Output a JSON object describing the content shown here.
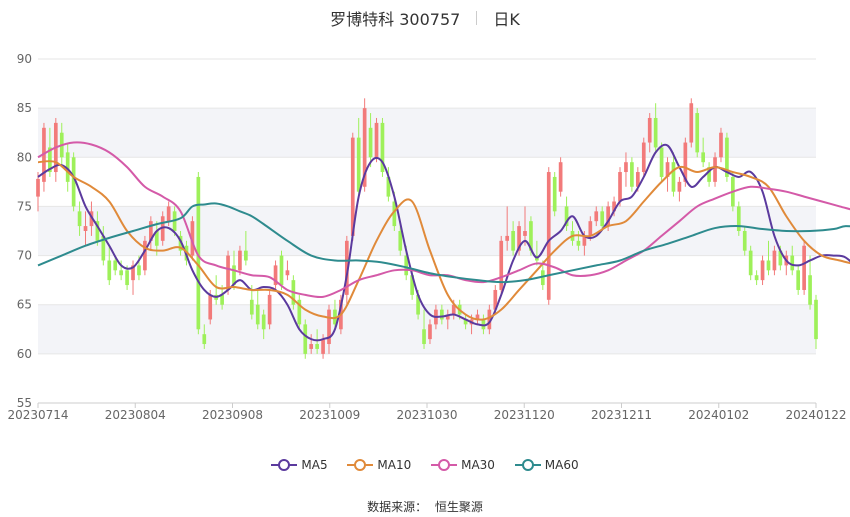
{
  "title": {
    "name": "罗博特科 300757",
    "period": "日K"
  },
  "source": {
    "label": "数据来源：",
    "value": "恒生聚源"
  },
  "colors": {
    "up": "#f27a7a",
    "down": "#9ef05a",
    "grid": "#e6e6e6",
    "band": "#f3f4f8",
    "axis_text": "#666666"
  },
  "chart_data": {
    "type": "candlestick",
    "ylim": [
      55,
      90
    ],
    "yticks": [
      55,
      60,
      65,
      70,
      75,
      80,
      85,
      90
    ],
    "xticks": [
      "20230714",
      "20230804",
      "20230908",
      "20231009",
      "20231030",
      "20231120",
      "20231211",
      "20240102",
      "20240122"
    ],
    "candles": [
      {
        "o": 76.0,
        "h": 78.5,
        "l": 74.5,
        "c": 77.8
      },
      {
        "o": 77.5,
        "h": 83.5,
        "l": 76.5,
        "c": 83.0
      },
      {
        "o": 81.0,
        "h": 83.0,
        "l": 78.0,
        "c": 78.5
      },
      {
        "o": 78.5,
        "h": 84.0,
        "l": 77.5,
        "c": 83.5
      },
      {
        "o": 82.5,
        "h": 83.5,
        "l": 79.0,
        "c": 80.0
      },
      {
        "o": 80.5,
        "h": 81.5,
        "l": 76.5,
        "c": 77.5
      },
      {
        "o": 80.0,
        "h": 80.5,
        "l": 74.5,
        "c": 75.0
      },
      {
        "o": 74.5,
        "h": 75.5,
        "l": 72.0,
        "c": 73.0
      },
      {
        "o": 72.5,
        "h": 74.5,
        "l": 71.0,
        "c": 73.0
      },
      {
        "o": 73.0,
        "h": 75.5,
        "l": 72.0,
        "c": 74.5
      },
      {
        "o": 73.5,
        "h": 74.5,
        "l": 71.0,
        "c": 71.5
      },
      {
        "o": 72.0,
        "h": 73.0,
        "l": 69.0,
        "c": 69.5
      },
      {
        "o": 69.5,
        "h": 71.0,
        "l": 67.0,
        "c": 67.5
      },
      {
        "o": 69.5,
        "h": 70.0,
        "l": 68.0,
        "c": 68.5
      },
      {
        "o": 68.5,
        "h": 69.5,
        "l": 67.5,
        "c": 68.0
      },
      {
        "o": 68.5,
        "h": 69.0,
        "l": 66.5,
        "c": 67.0
      },
      {
        "o": 67.5,
        "h": 69.5,
        "l": 66.0,
        "c": 69.0
      },
      {
        "o": 69.0,
        "h": 70.0,
        "l": 67.5,
        "c": 68.0
      },
      {
        "o": 68.5,
        "h": 72.0,
        "l": 68.0,
        "c": 71.5
      },
      {
        "o": 71.5,
        "h": 74.0,
        "l": 70.5,
        "c": 73.5
      },
      {
        "o": 72.5,
        "h": 73.5,
        "l": 70.0,
        "c": 71.0
      },
      {
        "o": 71.5,
        "h": 74.5,
        "l": 71.0,
        "c": 74.0
      },
      {
        "o": 73.5,
        "h": 75.5,
        "l": 73.0,
        "c": 75.0
      },
      {
        "o": 74.5,
        "h": 75.0,
        "l": 72.0,
        "c": 72.5
      },
      {
        "o": 72.0,
        "h": 72.5,
        "l": 70.0,
        "c": 70.5
      },
      {
        "o": 71.0,
        "h": 71.5,
        "l": 69.0,
        "c": 69.5
      },
      {
        "o": 70.0,
        "h": 74.0,
        "l": 69.5,
        "c": 73.5
      },
      {
        "o": 78.0,
        "h": 78.5,
        "l": 62.0,
        "c": 62.5
      },
      {
        "o": 62.0,
        "h": 63.0,
        "l": 60.5,
        "c": 61.0
      },
      {
        "o": 63.5,
        "h": 66.5,
        "l": 63.0,
        "c": 66.0
      },
      {
        "o": 66.0,
        "h": 68.0,
        "l": 65.0,
        "c": 65.5
      },
      {
        "o": 66.0,
        "h": 67.0,
        "l": 64.5,
        "c": 65.0
      },
      {
        "o": 66.5,
        "h": 70.5,
        "l": 66.0,
        "c": 70.0
      },
      {
        "o": 69.0,
        "h": 70.5,
        "l": 66.5,
        "c": 67.0
      },
      {
        "o": 68.5,
        "h": 71.0,
        "l": 68.0,
        "c": 70.5
      },
      {
        "o": 70.5,
        "h": 72.5,
        "l": 69.0,
        "c": 69.5
      },
      {
        "o": 65.5,
        "h": 67.0,
        "l": 63.5,
        "c": 64.0
      },
      {
        "o": 65.0,
        "h": 66.5,
        "l": 62.5,
        "c": 63.0
      },
      {
        "o": 64.0,
        "h": 64.5,
        "l": 61.5,
        "c": 62.5
      },
      {
        "o": 63.0,
        "h": 66.5,
        "l": 62.5,
        "c": 66.0
      },
      {
        "o": 67.0,
        "h": 69.5,
        "l": 66.5,
        "c": 69.0
      },
      {
        "o": 70.0,
        "h": 70.5,
        "l": 66.5,
        "c": 67.0
      },
      {
        "o": 68.0,
        "h": 69.5,
        "l": 67.5,
        "c": 68.5
      },
      {
        "o": 67.5,
        "h": 68.0,
        "l": 64.5,
        "c": 65.0
      },
      {
        "o": 65.5,
        "h": 66.0,
        "l": 62.5,
        "c": 63.0
      },
      {
        "o": 63.0,
        "h": 63.5,
        "l": 59.5,
        "c": 60.0
      },
      {
        "o": 60.5,
        "h": 62.0,
        "l": 60.0,
        "c": 61.0
      },
      {
        "o": 61.0,
        "h": 62.5,
        "l": 60.0,
        "c": 60.5
      },
      {
        "o": 60.0,
        "h": 62.0,
        "l": 59.5,
        "c": 61.5
      },
      {
        "o": 61.0,
        "h": 65.0,
        "l": 60.0,
        "c": 64.5
      },
      {
        "o": 64.5,
        "h": 65.5,
        "l": 62.5,
        "c": 63.0
      },
      {
        "o": 62.5,
        "h": 66.0,
        "l": 62.0,
        "c": 65.5
      },
      {
        "o": 66.0,
        "h": 72.0,
        "l": 65.0,
        "c": 71.5
      },
      {
        "o": 72.0,
        "h": 82.5,
        "l": 71.5,
        "c": 82.0
      },
      {
        "o": 82.0,
        "h": 84.0,
        "l": 76.0,
        "c": 76.5
      },
      {
        "o": 77.0,
        "h": 86.0,
        "l": 76.5,
        "c": 85.0
      },
      {
        "o": 83.0,
        "h": 84.5,
        "l": 79.0,
        "c": 80.0
      },
      {
        "o": 80.0,
        "h": 84.0,
        "l": 79.5,
        "c": 83.5
      },
      {
        "o": 83.5,
        "h": 84.0,
        "l": 78.0,
        "c": 78.5
      },
      {
        "o": 78.0,
        "h": 79.0,
        "l": 75.5,
        "c": 76.0
      },
      {
        "o": 75.5,
        "h": 76.5,
        "l": 72.5,
        "c": 73.0
      },
      {
        "o": 72.5,
        "h": 73.5,
        "l": 70.0,
        "c": 70.5
      },
      {
        "o": 70.0,
        "h": 71.0,
        "l": 67.5,
        "c": 68.0
      },
      {
        "o": 68.0,
        "h": 68.5,
        "l": 65.5,
        "c": 66.0
      },
      {
        "o": 66.0,
        "h": 66.5,
        "l": 63.5,
        "c": 64.0
      },
      {
        "o": 62.5,
        "h": 64.5,
        "l": 60.5,
        "c": 61.0
      },
      {
        "o": 61.5,
        "h": 63.5,
        "l": 61.0,
        "c": 63.0
      },
      {
        "o": 63.0,
        "h": 65.0,
        "l": 62.5,
        "c": 64.5
      },
      {
        "o": 64.5,
        "h": 65.0,
        "l": 63.0,
        "c": 63.5
      },
      {
        "o": 63.5,
        "h": 64.5,
        "l": 62.5,
        "c": 64.0
      },
      {
        "o": 64.0,
        "h": 65.5,
        "l": 63.5,
        "c": 65.0
      },
      {
        "o": 65.0,
        "h": 65.5,
        "l": 63.5,
        "c": 64.0
      },
      {
        "o": 63.5,
        "h": 64.0,
        "l": 62.5,
        "c": 63.0
      },
      {
        "o": 63.0,
        "h": 64.0,
        "l": 62.0,
        "c": 63.5
      },
      {
        "o": 63.5,
        "h": 64.5,
        "l": 63.0,
        "c": 64.0
      },
      {
        "o": 63.5,
        "h": 64.0,
        "l": 62.0,
        "c": 62.5
      },
      {
        "o": 62.5,
        "h": 65.0,
        "l": 62.0,
        "c": 64.5
      },
      {
        "o": 64.5,
        "h": 67.0,
        "l": 64.0,
        "c": 66.5
      },
      {
        "o": 66.5,
        "h": 72.0,
        "l": 66.0,
        "c": 71.5
      },
      {
        "o": 71.5,
        "h": 75.0,
        "l": 70.5,
        "c": 72.0
      },
      {
        "o": 72.5,
        "h": 73.5,
        "l": 70.0,
        "c": 70.5
      },
      {
        "o": 70.5,
        "h": 73.5,
        "l": 70.0,
        "c": 73.0
      },
      {
        "o": 72.0,
        "h": 75.0,
        "l": 71.0,
        "c": 72.5
      },
      {
        "o": 73.5,
        "h": 74.0,
        "l": 70.0,
        "c": 70.5
      },
      {
        "o": 70.0,
        "h": 71.5,
        "l": 69.0,
        "c": 69.5
      },
      {
        "o": 68.5,
        "h": 69.5,
        "l": 66.5,
        "c": 67.0
      },
      {
        "o": 65.5,
        "h": 79.0,
        "l": 65.0,
        "c": 78.5
      },
      {
        "o": 78.0,
        "h": 78.5,
        "l": 74.0,
        "c": 74.5
      },
      {
        "o": 76.5,
        "h": 80.0,
        "l": 76.0,
        "c": 79.5
      },
      {
        "o": 75.0,
        "h": 76.0,
        "l": 72.5,
        "c": 73.0
      },
      {
        "o": 72.5,
        "h": 73.5,
        "l": 71.0,
        "c": 71.5
      },
      {
        "o": 71.5,
        "h": 72.5,
        "l": 70.5,
        "c": 71.0
      },
      {
        "o": 71.0,
        "h": 72.5,
        "l": 70.0,
        "c": 72.0
      },
      {
        "o": 72.0,
        "h": 74.0,
        "l": 71.5,
        "c": 73.5
      },
      {
        "o": 73.5,
        "h": 75.0,
        "l": 73.0,
        "c": 74.5
      },
      {
        "o": 74.5,
        "h": 75.0,
        "l": 72.5,
        "c": 73.0
      },
      {
        "o": 73.0,
        "h": 75.5,
        "l": 72.5,
        "c": 75.0
      },
      {
        "o": 74.5,
        "h": 76.0,
        "l": 74.0,
        "c": 75.5
      },
      {
        "o": 75.5,
        "h": 79.0,
        "l": 75.0,
        "c": 78.5
      },
      {
        "o": 78.5,
        "h": 80.5,
        "l": 77.0,
        "c": 79.5
      },
      {
        "o": 79.5,
        "h": 80.0,
        "l": 76.5,
        "c": 77.0
      },
      {
        "o": 77.0,
        "h": 79.0,
        "l": 76.5,
        "c": 78.5
      },
      {
        "o": 78.5,
        "h": 82.0,
        "l": 78.0,
        "c": 81.5
      },
      {
        "o": 81.5,
        "h": 84.5,
        "l": 80.5,
        "c": 84.0
      },
      {
        "o": 84.0,
        "h": 85.5,
        "l": 80.5,
        "c": 81.0
      },
      {
        "o": 81.0,
        "h": 81.5,
        "l": 77.5,
        "c": 78.0
      },
      {
        "o": 78.0,
        "h": 80.0,
        "l": 76.5,
        "c": 79.5
      },
      {
        "o": 79.5,
        "h": 80.5,
        "l": 76.0,
        "c": 76.5
      },
      {
        "o": 76.5,
        "h": 78.0,
        "l": 75.5,
        "c": 77.5
      },
      {
        "o": 77.5,
        "h": 82.0,
        "l": 77.0,
        "c": 81.5
      },
      {
        "o": 81.5,
        "h": 86.0,
        "l": 81.0,
        "c": 85.5
      },
      {
        "o": 84.5,
        "h": 85.0,
        "l": 80.0,
        "c": 80.5
      },
      {
        "o": 80.5,
        "h": 82.0,
        "l": 79.0,
        "c": 79.5
      },
      {
        "o": 79.0,
        "h": 79.5,
        "l": 77.0,
        "c": 77.5
      },
      {
        "o": 77.5,
        "h": 80.5,
        "l": 77.0,
        "c": 80.0
      },
      {
        "o": 80.0,
        "h": 83.0,
        "l": 79.5,
        "c": 82.5
      },
      {
        "o": 82.0,
        "h": 82.5,
        "l": 77.5,
        "c": 78.0
      },
      {
        "o": 78.0,
        "h": 78.5,
        "l": 74.5,
        "c": 75.0
      },
      {
        "o": 75.0,
        "h": 75.5,
        "l": 72.0,
        "c": 72.5
      },
      {
        "o": 72.5,
        "h": 73.0,
        "l": 70.0,
        "c": 70.5
      },
      {
        "o": 70.5,
        "h": 71.0,
        "l": 67.5,
        "c": 68.0
      },
      {
        "o": 68.0,
        "h": 68.5,
        "l": 67.0,
        "c": 67.5
      },
      {
        "o": 67.5,
        "h": 70.0,
        "l": 67.0,
        "c": 69.5
      },
      {
        "o": 69.5,
        "h": 71.5,
        "l": 68.0,
        "c": 68.5
      },
      {
        "o": 68.5,
        "h": 71.0,
        "l": 68.0,
        "c": 70.5
      },
      {
        "o": 70.5,
        "h": 71.0,
        "l": 68.5,
        "c": 69.0
      },
      {
        "o": 69.0,
        "h": 70.5,
        "l": 68.0,
        "c": 70.0
      },
      {
        "o": 70.0,
        "h": 71.0,
        "l": 68.0,
        "c": 68.5
      },
      {
        "o": 68.5,
        "h": 69.0,
        "l": 66.0,
        "c": 66.5
      },
      {
        "o": 66.5,
        "h": 71.5,
        "l": 66.0,
        "c": 71.0
      },
      {
        "o": 68.0,
        "h": 70.0,
        "l": 64.5,
        "c": 65.0
      },
      {
        "o": 65.5,
        "h": 66.0,
        "l": 60.5,
        "c": 61.5
      }
    ],
    "series": [
      {
        "name": "MA5",
        "color": "#5b3a9e",
        "x": [
          0,
          2,
          4,
          6,
          8,
          10,
          12,
          14,
          16,
          18,
          20,
          22,
          24,
          26,
          28,
          30,
          32,
          34,
          36,
          38,
          40,
          42,
          44,
          46,
          48,
          50,
          52,
          54,
          56,
          58,
          60,
          62,
          64,
          66,
          68,
          70,
          72,
          74,
          76,
          78,
          80,
          82,
          84,
          86,
          88,
          90,
          92,
          94,
          96,
          98,
          100,
          102,
          104,
          106,
          108,
          110,
          112,
          114,
          116,
          118,
          120,
          122,
          124,
          126,
          128,
          130,
          132,
          134,
          136,
          138,
          139
        ],
        "y": [
          78.0,
          78.8,
          79.2,
          78.0,
          75.0,
          73.0,
          71.0,
          69.0,
          68.8,
          70.5,
          72.5,
          72.8,
          71.5,
          68.5,
          66.5,
          65.8,
          66.5,
          67.5,
          66.5,
          66.8,
          66.5,
          65.0,
          62.5,
          61.5,
          61.5,
          62.5,
          68.0,
          76.0,
          79.5,
          79.5,
          76.0,
          70.5,
          66.0,
          64.0,
          63.8,
          64.0,
          63.5,
          63.0,
          63.2,
          66.0,
          69.5,
          71.5,
          69.8,
          71.5,
          72.5,
          74.0,
          72.0,
          72.0,
          73.5,
          75.5,
          76.0,
          78.0,
          80.5,
          81.2,
          79.0,
          77.0,
          78.0,
          79.0,
          78.5,
          78.0,
          78.5,
          76.5,
          72.0,
          69.5,
          69.0,
          69.5,
          70.0,
          70.0,
          69.8,
          68.5,
          67.0
        ]
      },
      {
        "name": "MA10",
        "color": "#e08a3a",
        "x": [
          0,
          3,
          6,
          9,
          12,
          15,
          18,
          21,
          24,
          27,
          30,
          33,
          36,
          39,
          42,
          45,
          48,
          51,
          54,
          57,
          60,
          63,
          66,
          69,
          72,
          75,
          78,
          81,
          84,
          87,
          90,
          93,
          96,
          99,
          102,
          105,
          108,
          111,
          114,
          117,
          120,
          123,
          126,
          129,
          132,
          135,
          138,
          139
        ],
        "y": [
          79.5,
          79.5,
          78.0,
          77.0,
          75.5,
          72.5,
          70.8,
          70.5,
          70.8,
          69.0,
          66.8,
          66.8,
          66.5,
          66.5,
          66.0,
          64.5,
          63.8,
          64.0,
          67.5,
          71.5,
          74.5,
          75.5,
          70.5,
          66.0,
          64.0,
          63.5,
          64.5,
          66.5,
          68.5,
          70.5,
          72.0,
          72.0,
          73.0,
          73.5,
          75.5,
          77.5,
          79.0,
          78.5,
          79.0,
          78.5,
          78.0,
          77.0,
          74.0,
          71.5,
          70.0,
          69.5,
          69.0,
          68.5
        ]
      },
      {
        "name": "MA30",
        "color": "#d45aa8",
        "x": [
          0,
          3,
          6,
          9,
          12,
          15,
          18,
          21,
          24,
          27,
          30,
          33,
          36,
          39,
          42,
          45,
          48,
          51,
          54,
          57,
          60,
          63,
          66,
          69,
          72,
          75,
          78,
          81,
          84,
          87,
          90,
          93,
          96,
          99,
          102,
          105,
          108,
          111,
          114,
          117,
          120,
          123,
          126,
          129,
          132,
          135,
          138,
          139
        ],
        "y": [
          80.0,
          81.0,
          81.5,
          81.3,
          80.5,
          79.0,
          77.0,
          76.0,
          74.5,
          70.0,
          69.0,
          68.5,
          68.0,
          67.8,
          66.5,
          66.0,
          65.8,
          66.5,
          67.5,
          68.0,
          68.5,
          68.5,
          68.0,
          68.0,
          67.5,
          67.3,
          67.8,
          68.5,
          69.2,
          68.8,
          68.0,
          68.0,
          68.5,
          69.5,
          70.5,
          72.0,
          73.5,
          75.0,
          75.8,
          76.5,
          77.0,
          76.8,
          76.5,
          76.0,
          75.5,
          75.0,
          74.5,
          74.2
        ]
      },
      {
        "name": "MA60",
        "color": "#2e8b8e",
        "x": [
          0,
          4,
          8,
          12,
          16,
          20,
          24,
          26,
          28,
          30,
          32,
          34,
          36,
          38,
          42,
          46,
          50,
          54,
          58,
          62,
          66,
          70,
          74,
          78,
          82,
          86,
          90,
          94,
          98,
          102,
          106,
          110,
          114,
          118,
          122,
          126,
          130,
          134,
          136,
          139
        ],
        "y": [
          69.0,
          70.0,
          71.0,
          71.8,
          72.5,
          73.2,
          73.8,
          75.0,
          75.2,
          75.3,
          75.0,
          74.5,
          74.0,
          73.2,
          71.5,
          70.0,
          69.5,
          69.5,
          69.3,
          68.8,
          68.2,
          67.8,
          67.5,
          67.3,
          67.5,
          68.0,
          68.5,
          69.0,
          69.5,
          70.5,
          71.2,
          72.0,
          72.8,
          73.0,
          72.7,
          72.5,
          72.5,
          72.7,
          73.0,
          72.8
        ]
      }
    ]
  }
}
